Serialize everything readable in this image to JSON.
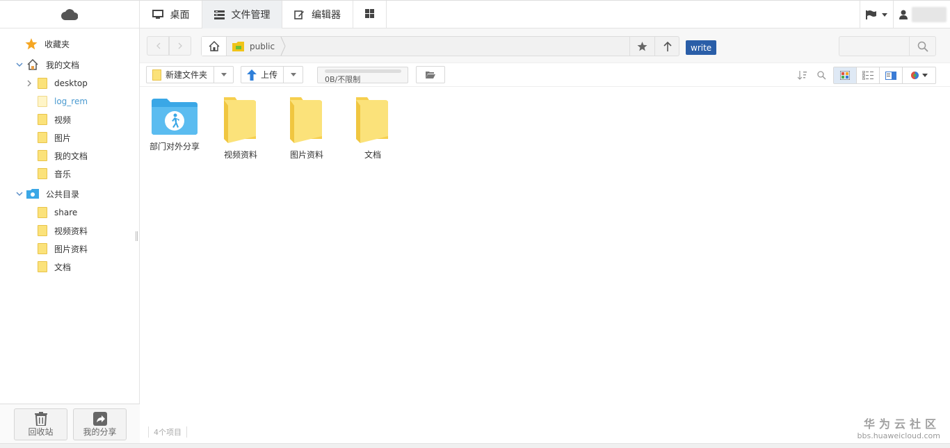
{
  "nav": {
    "tabs": [
      {
        "label": "桌面",
        "icon": "monitor-icon"
      },
      {
        "label": "文件管理",
        "icon": "file-manager-icon"
      },
      {
        "label": "编辑器",
        "icon": "edit-icon"
      },
      {
        "label": "",
        "icon": "apps-grid-icon"
      }
    ],
    "active_tab": "文件管理"
  },
  "sidebar": {
    "favorites": "收藏夹",
    "my_docs": "我的文档",
    "my_docs_children": [
      "desktop",
      "log_rem",
      "视频",
      "图片",
      "我的文档",
      "音乐"
    ],
    "selected": "log_rem",
    "public_dir": "公共目录",
    "public_children": [
      "share",
      "视频资料",
      "图片资料",
      "文档"
    ],
    "footer": {
      "trash": "回收站",
      "my_share": "我的分享"
    }
  },
  "addressbar": {
    "crumb": "public",
    "permission_badge": "write",
    "search_placeholder": ""
  },
  "toolbar": {
    "new_folder": "新建文件夹",
    "upload": "上传",
    "quota_text": "0B/不限制",
    "quota_used_fraction": 0
  },
  "files": [
    {
      "name": "部门对外分享",
      "icon": "shared-folder-icon"
    },
    {
      "name": "视频资料",
      "icon": "folder-icon"
    },
    {
      "name": "图片资料",
      "icon": "folder-icon"
    },
    {
      "name": "文档",
      "icon": "folder-icon"
    }
  ],
  "status": {
    "count": "4个项目"
  },
  "watermark": {
    "title": "华为云社区",
    "url": "bbs.huaweicloud.com"
  },
  "colors": {
    "accent": "#2a5ea8",
    "folder": "#fbe27a",
    "shared_folder": "#3aa7e6",
    "selected_text": "#4a9ad0"
  }
}
